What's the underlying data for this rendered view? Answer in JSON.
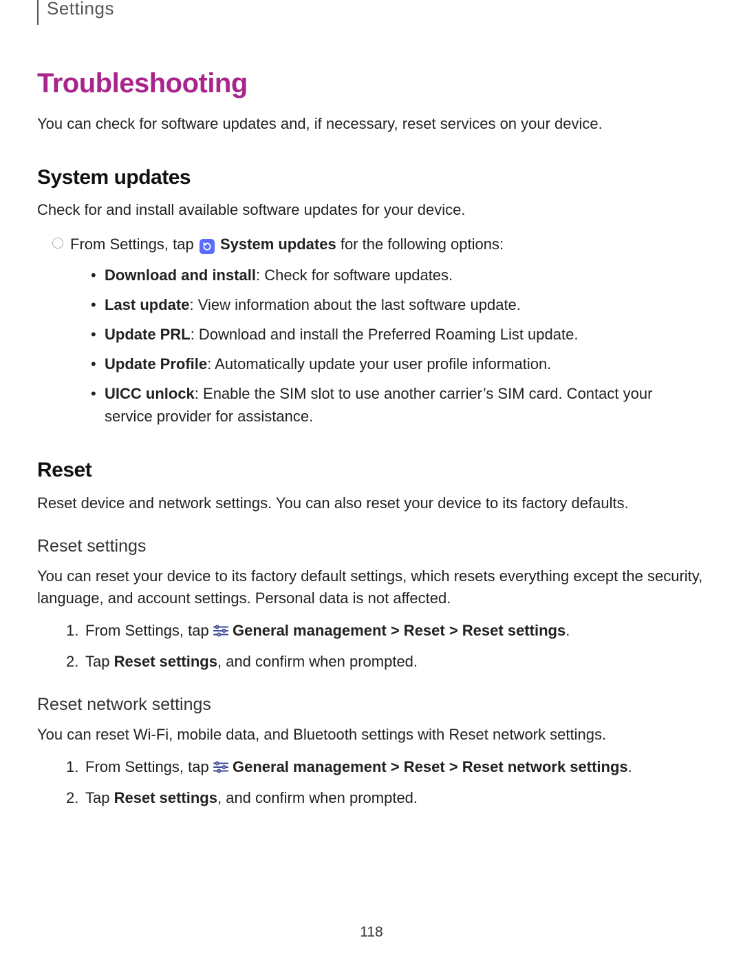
{
  "header": {
    "label": "Settings"
  },
  "title": "Troubleshooting",
  "intro": "You can check for software updates and, if necessary, reset services on your device.",
  "sys": {
    "heading": "System updates",
    "intro": "Check for and install available software updates for your device.",
    "instr_pre": "From Settings, tap ",
    "instr_bold": "System updates",
    "instr_post": " for the following options:",
    "items": [
      {
        "b": "Download and install",
        "t": ": Check for software updates."
      },
      {
        "b": "Last update",
        "t": ": View information about the last software update."
      },
      {
        "b": "Update PRL",
        "t": ": Download and install the Preferred Roaming List update."
      },
      {
        "b": "Update Profile",
        "t": ": Automatically update your user profile information."
      },
      {
        "b": "UICC unlock",
        "t": ": Enable the SIM slot to use another carrier’s SIM card. Contact your service provider for assistance."
      }
    ]
  },
  "reset": {
    "heading": "Reset",
    "intro": "Reset device and network settings. You can also reset your device to its factory defaults.",
    "rs": {
      "heading": "Reset settings",
      "intro": "You can reset your device to its factory default settings, which resets everything except the security, language, and account settings. Personal data is not affected.",
      "step1_pre": "From Settings, tap ",
      "step1_bold": "General management > Reset > Reset settings",
      "step1_post": ".",
      "step2_pre": "Tap ",
      "step2_bold": "Reset settings",
      "step2_post": ", and confirm when prompted."
    },
    "rns": {
      "heading": "Reset network settings",
      "intro": "You can reset Wi-Fi, mobile data, and Bluetooth settings with Reset network settings.",
      "step1_pre": "From Settings, tap ",
      "step1_bold": "General management > Reset > Reset network settings",
      "step1_post": ".",
      "step2_pre": "Tap ",
      "step2_bold": "Reset settings",
      "step2_post": ", and confirm when prompted."
    }
  },
  "page_number": "118"
}
